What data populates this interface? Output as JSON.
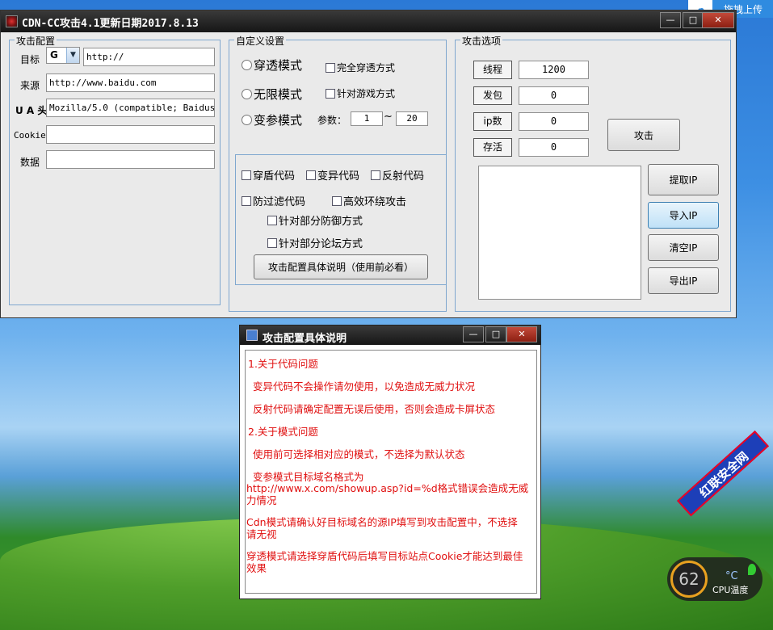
{
  "window": {
    "title": "CDN-CC攻击4.1更新日期2017.8.13",
    "min_glyph": "—",
    "max_glyph": "□",
    "close_glyph": "✕"
  },
  "upload": {
    "label": "拖拽上传"
  },
  "attack_config": {
    "label": "攻击配置",
    "target_label": "目标",
    "target_protocol": "G",
    "target_value": "http://",
    "source_label": "来源",
    "source_value": "http://www.baidu.com",
    "ua_label": "U A 头",
    "ua_value": "Mozilla/5.0 (compatible; Baiduspid",
    "cookie_label": "Cookie",
    "cookie_value": "",
    "data_label": "数据",
    "data_value": ""
  },
  "custom_settings": {
    "label": "自定义设置",
    "modes": [
      "穿透模式",
      "无限模式",
      "变参模式"
    ],
    "full_penetration": "完全穿透方式",
    "game_mode": "针对游戏方式",
    "param_label": "参数：",
    "param_from": "1",
    "param_sep": "~",
    "param_to": "20",
    "codes": {
      "shield": "穿盾代码",
      "mutate": "变异代码",
      "reflect": "反射代码",
      "anti_filter": "防过滤代码",
      "loop_attack": "高效环绕攻击",
      "partial_defense": "针对部分防御方式",
      "partial_forum": "针对部分论坛方式"
    },
    "help_button": "攻击配置具体说明（使用前必看）"
  },
  "attack_options": {
    "label": "攻击选项",
    "fields": [
      {
        "label": "线程",
        "value": "1200"
      },
      {
        "label": "发包",
        "value": "0"
      },
      {
        "label": "ip数",
        "value": "0"
      },
      {
        "label": "存活",
        "value": "0"
      }
    ],
    "attack_button": "攻击",
    "extract_button": "提取IP",
    "import_button": "导入IP",
    "clear_button": "清空IP",
    "export_button": "导出IP"
  },
  "dialog": {
    "title": "攻击配置具体说明",
    "lines": [
      "1.关于代码问题",
      "变异代码不会操作请勿使用，以免造成无威力状况",
      "反射代码请确定配置无误后使用，否则会造成卡屏状态",
      "2.关于模式问题",
      "使用前可选择相对应的模式，不选择为默认状态",
      "变参模式目标域名格式为",
      "http://www.x.com/showup.asp?id=%d格式错误会造成无威力情况",
      "Cdn模式请确认好目标域名的源IP填写到攻击配置中，不选择请无视",
      "穿透模式请选择穿盾代码后填写目标站点Cookie才能达到最佳效果"
    ]
  },
  "gadget": {
    "value": "62",
    "unit": "°C",
    "caption": "CPU温度"
  },
  "watermark": "红联安全网"
}
